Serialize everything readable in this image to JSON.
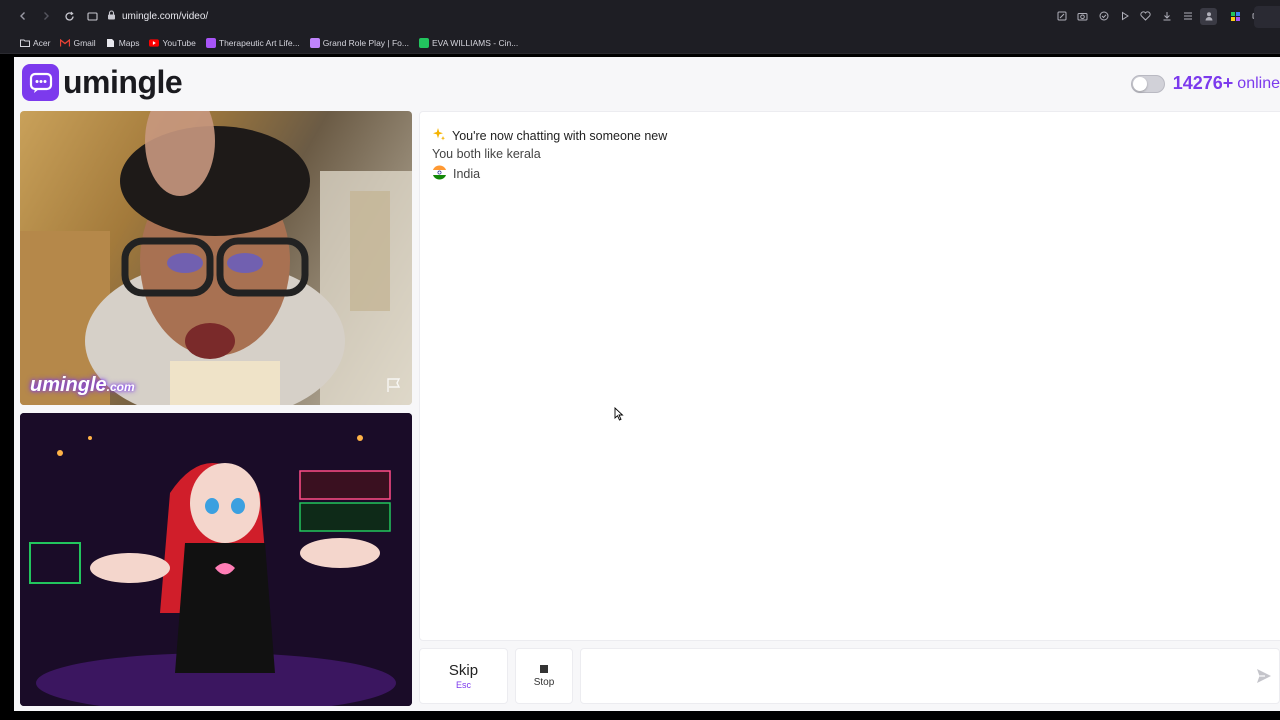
{
  "browser": {
    "url": "umingle.com/video/",
    "bookmarks": [
      {
        "label": "Acer",
        "icon": "folder-icon",
        "color": "#d4d4dc"
      },
      {
        "label": "Gmail",
        "icon": "gmail-icon",
        "color": "#ea4335"
      },
      {
        "label": "Maps",
        "icon": "maps-icon",
        "color": "#d4d4dc"
      },
      {
        "label": "YouTube",
        "icon": "youtube-icon",
        "color": "#ff0000"
      },
      {
        "label": "Therapeutic Art Life...",
        "icon": "site-icon",
        "color": "#a855f7"
      },
      {
        "label": "Grand Role Play | Fo...",
        "icon": "site-icon",
        "color": "#c084fc"
      },
      {
        "label": "EVA WILLIAMS - Cin...",
        "icon": "site-icon",
        "color": "#22c55e"
      }
    ]
  },
  "header": {
    "brand": "umingle",
    "online_count": "14276+",
    "online_label": "online",
    "toggle_on": false
  },
  "video": {
    "watermark_main": "umingle",
    "watermark_suffix": ".com"
  },
  "chat": {
    "system_message": "You're now chatting with someone new",
    "system_icon": "sparkles-icon",
    "shared_interest": "You both like kerala",
    "country": "India",
    "country_icon": "india-flag-icon"
  },
  "controls": {
    "skip_label": "Skip",
    "skip_hint": "Esc",
    "stop_label": "Stop",
    "message_placeholder": ""
  },
  "colors": {
    "accent": "#7c3aed",
    "chrome_bg": "#1e1e24",
    "page_bg": "#f7f7f9"
  }
}
